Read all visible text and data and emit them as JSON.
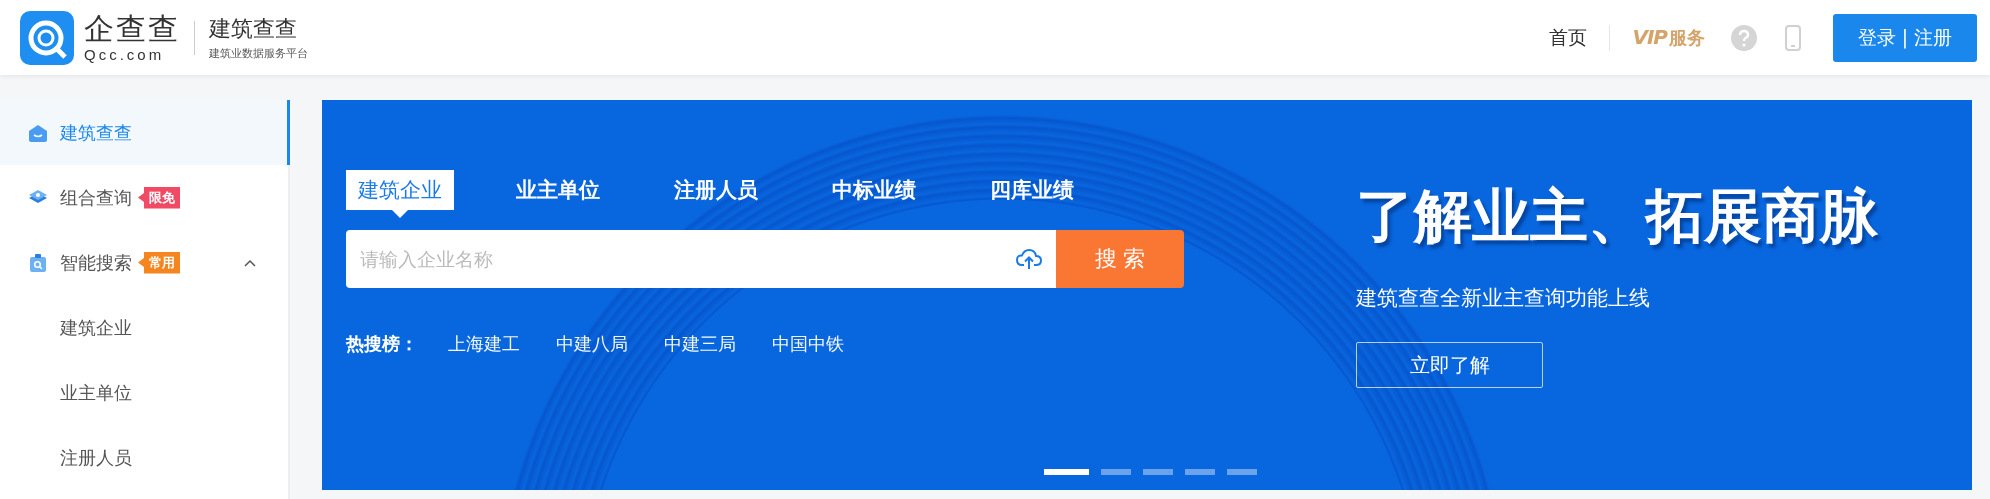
{
  "header": {
    "logo_text": "企查查",
    "logo_domain": "Qcc.com",
    "product_name": "建筑查查",
    "product_tagline": "建筑业数据服务平台",
    "home_link": "首页",
    "vip_mark": "VIP",
    "vip_label": "服务",
    "login_button": "登录 | 注册"
  },
  "sidebar": {
    "items": [
      {
        "label": "建筑查查",
        "selected": true
      },
      {
        "label": "组合查询",
        "selected": false,
        "badge": {
          "text": "限免",
          "color": "#f04a64"
        }
      },
      {
        "label": "智能搜索",
        "selected": false,
        "badge": {
          "text": "常用",
          "color": "#f5861f"
        },
        "expanded": true,
        "children": [
          {
            "label": "建筑企业",
            "selected": false
          },
          {
            "label": "业主单位",
            "selected": false
          },
          {
            "label": "注册人员",
            "selected": false
          }
        ]
      }
    ]
  },
  "banner": {
    "tabs": [
      {
        "label": "建筑企业",
        "selected": true
      },
      {
        "label": "业主单位",
        "selected": false
      },
      {
        "label": "注册人员",
        "selected": false
      },
      {
        "label": "中标业绩",
        "selected": false
      },
      {
        "label": "四库业绩",
        "selected": false
      }
    ],
    "search": {
      "placeholder": "请输入企业名称",
      "button": "搜 索"
    },
    "hot_label": "热搜榜：",
    "hot_items": [
      "上海建工",
      "中建八局",
      "中建三局",
      "中国中铁"
    ],
    "headline": "了解业主、拓展商脉",
    "subtitle": "建筑查查全新业主查询功能上线",
    "cta_button": "立即了解",
    "slides": [
      {
        "selected": true
      },
      {
        "selected": false
      },
      {
        "selected": false
      },
      {
        "selected": false
      },
      {
        "selected": false
      }
    ]
  }
}
